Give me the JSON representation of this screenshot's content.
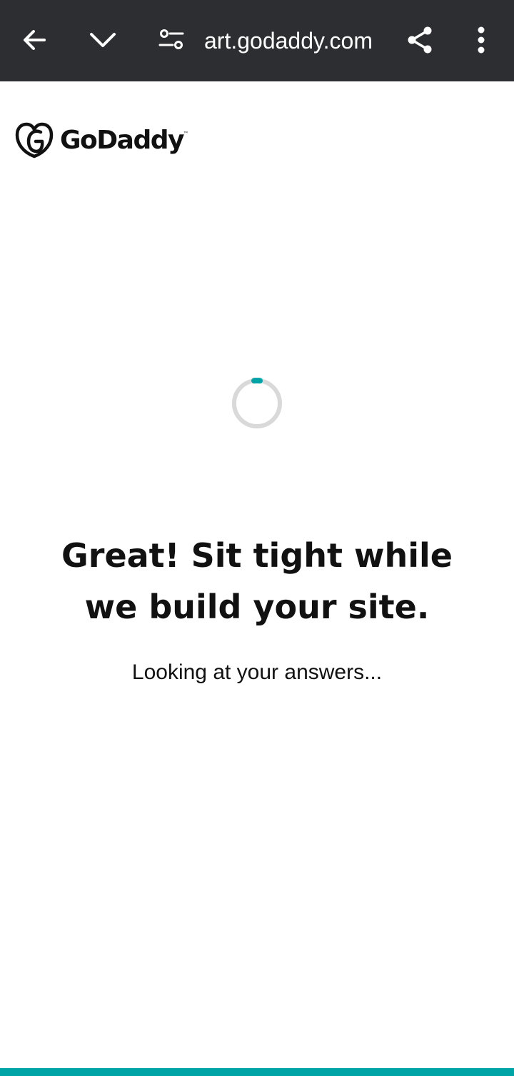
{
  "browser": {
    "url": "art.godaddy.com",
    "icons": {
      "back": "arrow-left-icon",
      "collapse": "chevron-down-icon",
      "site_settings": "tune-icon",
      "share": "share-icon",
      "menu": "more-vert-icon"
    },
    "colors": {
      "toolbar_bg": "#2d2e31",
      "toolbar_fg": "#ffffff"
    }
  },
  "page": {
    "logo": {
      "text": "GoDaddy",
      "trademark": "™"
    },
    "headline": "Great! Sit tight while we build your site.",
    "status": "Looking at your answers...",
    "spinner": {
      "track_color": "#d9d9d9",
      "accent_color": "#00a4a6"
    },
    "progress": {
      "fraction": 1.0,
      "color": "#00a4a6"
    }
  }
}
